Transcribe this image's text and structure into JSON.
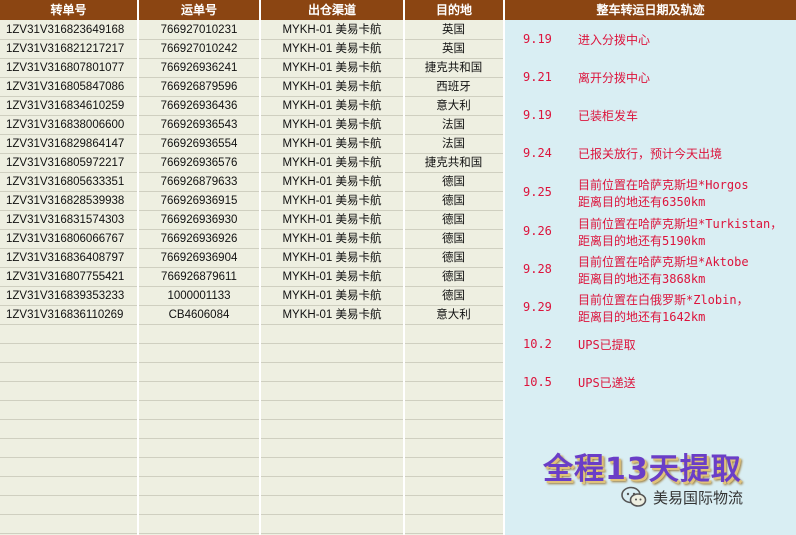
{
  "table": {
    "headers": [
      "转单号",
      "运单号",
      "出仓渠道",
      "目的地"
    ],
    "rows": [
      [
        "1ZV31V316823649168",
        "766927010231",
        "MYKH-01 美易卡航",
        "英国"
      ],
      [
        "1ZV31V316821217217",
        "766927010242",
        "MYKH-01 美易卡航",
        "英国"
      ],
      [
        "1ZV31V316807801077",
        "766926936241",
        "MYKH-01 美易卡航",
        "捷克共和国"
      ],
      [
        "1ZV31V316805847086",
        "766926879596",
        "MYKH-01 美易卡航",
        "西班牙"
      ],
      [
        "1ZV31V316834610259",
        "766926936436",
        "MYKH-01 美易卡航",
        "意大利"
      ],
      [
        "1ZV31V316838006600",
        "766926936543",
        "MYKH-01 美易卡航",
        "法国"
      ],
      [
        "1ZV31V316829864147",
        "766926936554",
        "MYKH-01 美易卡航",
        "法国"
      ],
      [
        "1ZV31V316805972217",
        "766926936576",
        "MYKH-01 美易卡航",
        "捷克共和国"
      ],
      [
        "1ZV31V316805633351",
        "766926879633",
        "MYKH-01 美易卡航",
        "德国"
      ],
      [
        "1ZV31V316828539938",
        "766926936915",
        "MYKH-01 美易卡航",
        "德国"
      ],
      [
        "1ZV31V316831574303",
        "766926936930",
        "MYKH-01 美易卡航",
        "德国"
      ],
      [
        "1ZV31V316806066767",
        "766926936926",
        "MYKH-01 美易卡航",
        "德国"
      ],
      [
        "1ZV31V316836408797",
        "766926936904",
        "MYKH-01 美易卡航",
        "德国"
      ],
      [
        "1ZV31V316807755421",
        "766926879611",
        "MYKH-01 美易卡航",
        "德国"
      ],
      [
        "1ZV31V316839353233",
        "1000001133",
        "MYKH-01 美易卡航",
        "德国"
      ],
      [
        "1ZV31V316836110269",
        "CB4606084",
        "MYKH-01 美易卡航",
        "意大利"
      ]
    ]
  },
  "tracking": {
    "header": "整车转运日期及轨迹",
    "events": [
      {
        "date": "9.19",
        "lines": [
          "进入分拨中心"
        ]
      },
      {
        "date": "9.21",
        "lines": [
          "离开分拨中心"
        ]
      },
      {
        "date": "9.19",
        "lines": [
          "已装柜发车"
        ]
      },
      {
        "date": "9.24",
        "lines": [
          "已报关放行，预计今天出境"
        ]
      },
      {
        "date": "9.25",
        "lines": [
          "目前位置在哈萨克斯坦*Horgos",
          "距离目的地还有6350km"
        ]
      },
      {
        "date": "9.26",
        "lines": [
          "目前位置在哈萨克斯坦*Turkistan，",
          "距离目的地还有5190km"
        ]
      },
      {
        "date": "9.28",
        "lines": [
          "目前位置在哈萨克斯坦*Aktobe",
          "距离目的地还有3868km"
        ]
      },
      {
        "date": "9.29",
        "lines": [
          "目前位置在白俄罗斯*Zlobin，",
          "距离目的地还有1642km"
        ]
      },
      {
        "date": "10.2",
        "lines": [
          "UPS已提取"
        ]
      },
      {
        "date": "10.5",
        "lines": [
          "UPS已递送"
        ]
      }
    ]
  },
  "banner": {
    "title_pre": "全程",
    "title_num": "13",
    "title_post": "天提取"
  },
  "watermark": {
    "text": "美易国际物流",
    "icon": "wechat-icon"
  },
  "colors": {
    "header_bg": "#8b4512",
    "event_text": "#dc143c",
    "banner_text": "#6a3ec7",
    "panel_bg": "#d9eef3",
    "sheet_bg": "#eeefe1"
  }
}
